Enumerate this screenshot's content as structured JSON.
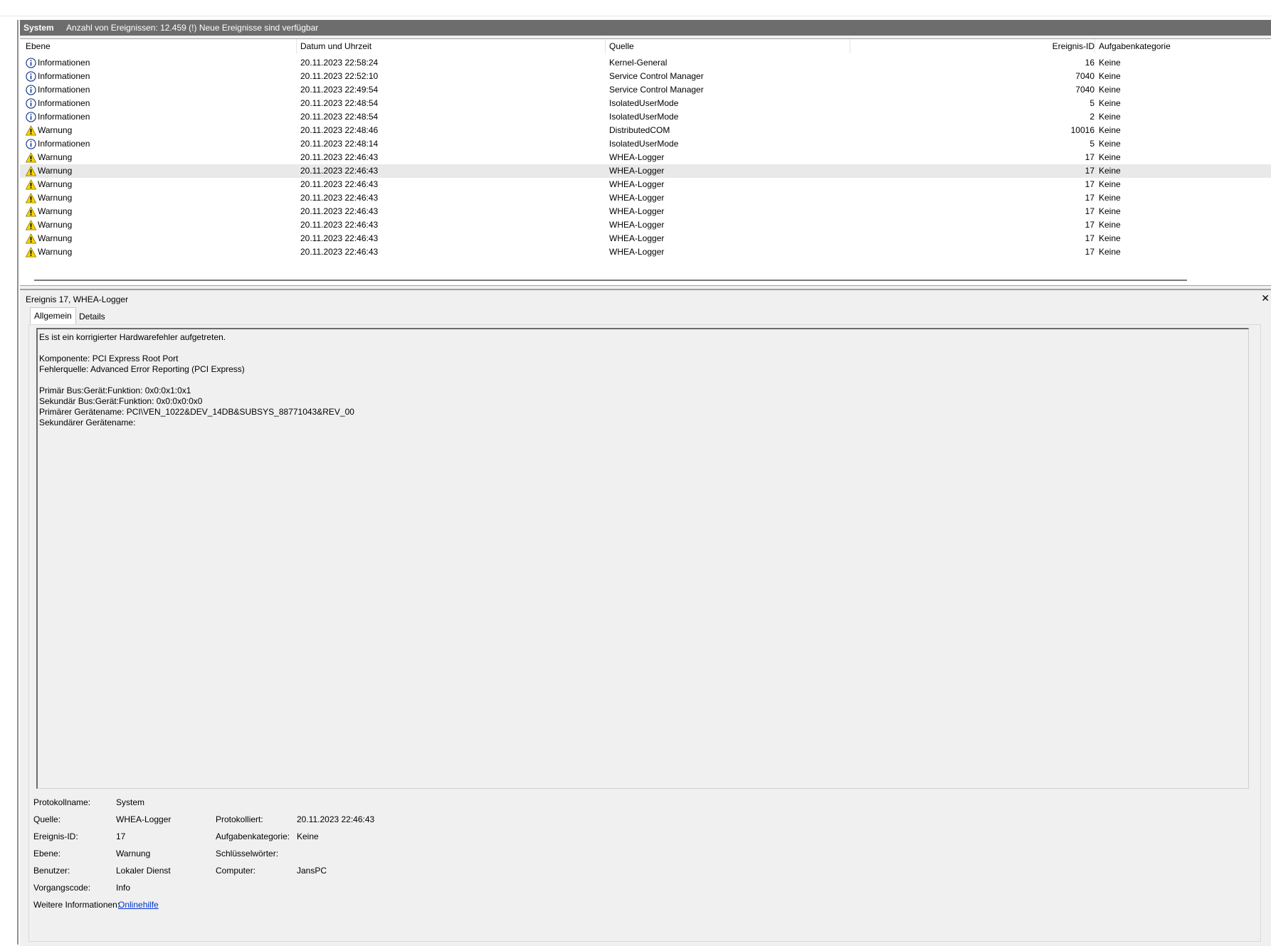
{
  "header": {
    "log_name": "System",
    "event_count": "Anzahl von Ereignissen: 12.459 (!) Neue Ereignisse sind verfügbar"
  },
  "columns": [
    "Ebene",
    "Datum und Uhrzeit",
    "Quelle",
    "Ereignis-ID",
    "Aufgabenkategorie"
  ],
  "events": [
    {
      "level": "Informationen",
      "icon": "info-icon",
      "date": "20.11.2023 22:58:24",
      "source": "Kernel-General",
      "id": "16",
      "category": "Keine"
    },
    {
      "level": "Informationen",
      "icon": "info-icon",
      "date": "20.11.2023 22:52:10",
      "source": "Service Control Manager",
      "id": "7040",
      "category": "Keine"
    },
    {
      "level": "Informationen",
      "icon": "info-icon",
      "date": "20.11.2023 22:49:54",
      "source": "Service Control Manager",
      "id": "7040",
      "category": "Keine"
    },
    {
      "level": "Informationen",
      "icon": "info-icon",
      "date": "20.11.2023 22:48:54",
      "source": "IsolatedUserMode",
      "id": "5",
      "category": "Keine"
    },
    {
      "level": "Informationen",
      "icon": "info-icon",
      "date": "20.11.2023 22:48:54",
      "source": "IsolatedUserMode",
      "id": "2",
      "category": "Keine"
    },
    {
      "level": "Warnung",
      "icon": "warning-icon",
      "date": "20.11.2023 22:48:46",
      "source": "DistributedCOM",
      "id": "10016",
      "category": "Keine"
    },
    {
      "level": "Informationen",
      "icon": "info-icon",
      "date": "20.11.2023 22:48:14",
      "source": "IsolatedUserMode",
      "id": "5",
      "category": "Keine"
    },
    {
      "level": "Warnung",
      "icon": "warning-icon",
      "date": "20.11.2023 22:46:43",
      "source": "WHEA-Logger",
      "id": "17",
      "category": "Keine"
    },
    {
      "level": "Warnung",
      "icon": "warning-icon",
      "date": "20.11.2023 22:46:43",
      "source": "WHEA-Logger",
      "id": "17",
      "category": "Keine",
      "selected": true
    },
    {
      "level": "Warnung",
      "icon": "warning-icon",
      "date": "20.11.2023 22:46:43",
      "source": "WHEA-Logger",
      "id": "17",
      "category": "Keine"
    },
    {
      "level": "Warnung",
      "icon": "warning-icon",
      "date": "20.11.2023 22:46:43",
      "source": "WHEA-Logger",
      "id": "17",
      "category": "Keine"
    },
    {
      "level": "Warnung",
      "icon": "warning-icon",
      "date": "20.11.2023 22:46:43",
      "source": "WHEA-Logger",
      "id": "17",
      "category": "Keine"
    },
    {
      "level": "Warnung",
      "icon": "warning-icon",
      "date": "20.11.2023 22:46:43",
      "source": "WHEA-Logger",
      "id": "17",
      "category": "Keine"
    },
    {
      "level": "Warnung",
      "icon": "warning-icon",
      "date": "20.11.2023 22:46:43",
      "source": "WHEA-Logger",
      "id": "17",
      "category": "Keine"
    },
    {
      "level": "Warnung",
      "icon": "warning-icon",
      "date": "20.11.2023 22:46:43",
      "source": "WHEA-Logger",
      "id": "17",
      "category": "Keine"
    }
  ],
  "detail": {
    "title": "Ereignis 17, WHEA-Logger",
    "close": "✕",
    "tabs": [
      "Allgemein",
      "Details"
    ],
    "description": [
      "Es ist ein korrigierter Hardwarefehler aufgetreten.",
      "",
      "Komponente: PCI Express Root Port",
      "Fehlerquelle: Advanced Error Reporting (PCI Express)",
      "",
      "Primär Bus:Gerät:Funktion: 0x0:0x1:0x1",
      "Sekundär Bus:Gerät:Funktion: 0x0:0x0:0x0",
      "Primärer Gerätename: PCI\\VEN_1022&DEV_14DB&SUBSYS_88771043&REV_00",
      "Sekundärer Gerätename:"
    ],
    "properties": {
      "log_name_label": "Protokollname:",
      "log_name": "System",
      "source_label": "Quelle:",
      "source": "WHEA-Logger",
      "logged_label": "Protokolliert:",
      "logged": "20.11.2023 22:46:43",
      "event_id_label": "Ereignis-ID:",
      "event_id": "17",
      "task_label": "Aufgabenkategorie:",
      "task": "Keine",
      "level_label": "Ebene:",
      "level": "Warnung",
      "keywords_label": "Schlüsselwörter:",
      "keywords": "",
      "user_label": "Benutzer:",
      "user": "Lokaler Dienst",
      "computer_label": "Computer:",
      "computer": "JansPC",
      "opcode_label": "Vorgangscode:",
      "opcode": "Info",
      "more_info_label": "Weitere Informationen:",
      "more_info_link": "Onlinehilfe"
    }
  },
  "colors": {
    "header_bar": "#6d6d6d",
    "selected_row": "#e9e9e9",
    "info_icon": "#1b3d8f",
    "warning_icon": "#f5d400",
    "link": "#0033cc"
  }
}
